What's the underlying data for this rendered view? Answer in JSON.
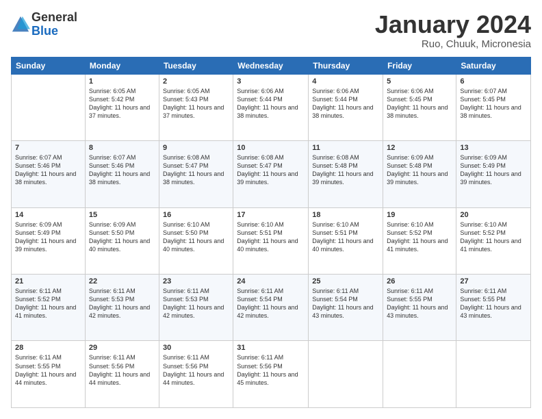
{
  "header": {
    "logo_general": "General",
    "logo_blue": "Blue",
    "month_title": "January 2024",
    "location": "Ruo, Chuuk, Micronesia"
  },
  "weekdays": [
    "Sunday",
    "Monday",
    "Tuesday",
    "Wednesday",
    "Thursday",
    "Friday",
    "Saturday"
  ],
  "weeks": [
    [
      {
        "day": "",
        "sunrise": "",
        "sunset": "",
        "daylight": ""
      },
      {
        "day": "1",
        "sunrise": "Sunrise: 6:05 AM",
        "sunset": "Sunset: 5:42 PM",
        "daylight": "Daylight: 11 hours and 37 minutes."
      },
      {
        "day": "2",
        "sunrise": "Sunrise: 6:05 AM",
        "sunset": "Sunset: 5:43 PM",
        "daylight": "Daylight: 11 hours and 37 minutes."
      },
      {
        "day": "3",
        "sunrise": "Sunrise: 6:06 AM",
        "sunset": "Sunset: 5:44 PM",
        "daylight": "Daylight: 11 hours and 38 minutes."
      },
      {
        "day": "4",
        "sunrise": "Sunrise: 6:06 AM",
        "sunset": "Sunset: 5:44 PM",
        "daylight": "Daylight: 11 hours and 38 minutes."
      },
      {
        "day": "5",
        "sunrise": "Sunrise: 6:06 AM",
        "sunset": "Sunset: 5:45 PM",
        "daylight": "Daylight: 11 hours and 38 minutes."
      },
      {
        "day": "6",
        "sunrise": "Sunrise: 6:07 AM",
        "sunset": "Sunset: 5:45 PM",
        "daylight": "Daylight: 11 hours and 38 minutes."
      }
    ],
    [
      {
        "day": "7",
        "sunrise": "Sunrise: 6:07 AM",
        "sunset": "Sunset: 5:46 PM",
        "daylight": "Daylight: 11 hours and 38 minutes."
      },
      {
        "day": "8",
        "sunrise": "Sunrise: 6:07 AM",
        "sunset": "Sunset: 5:46 PM",
        "daylight": "Daylight: 11 hours and 38 minutes."
      },
      {
        "day": "9",
        "sunrise": "Sunrise: 6:08 AM",
        "sunset": "Sunset: 5:47 PM",
        "daylight": "Daylight: 11 hours and 38 minutes."
      },
      {
        "day": "10",
        "sunrise": "Sunrise: 6:08 AM",
        "sunset": "Sunset: 5:47 PM",
        "daylight": "Daylight: 11 hours and 39 minutes."
      },
      {
        "day": "11",
        "sunrise": "Sunrise: 6:08 AM",
        "sunset": "Sunset: 5:48 PM",
        "daylight": "Daylight: 11 hours and 39 minutes."
      },
      {
        "day": "12",
        "sunrise": "Sunrise: 6:09 AM",
        "sunset": "Sunset: 5:48 PM",
        "daylight": "Daylight: 11 hours and 39 minutes."
      },
      {
        "day": "13",
        "sunrise": "Sunrise: 6:09 AM",
        "sunset": "Sunset: 5:49 PM",
        "daylight": "Daylight: 11 hours and 39 minutes."
      }
    ],
    [
      {
        "day": "14",
        "sunrise": "Sunrise: 6:09 AM",
        "sunset": "Sunset: 5:49 PM",
        "daylight": "Daylight: 11 hours and 39 minutes."
      },
      {
        "day": "15",
        "sunrise": "Sunrise: 6:09 AM",
        "sunset": "Sunset: 5:50 PM",
        "daylight": "Daylight: 11 hours and 40 minutes."
      },
      {
        "day": "16",
        "sunrise": "Sunrise: 6:10 AM",
        "sunset": "Sunset: 5:50 PM",
        "daylight": "Daylight: 11 hours and 40 minutes."
      },
      {
        "day": "17",
        "sunrise": "Sunrise: 6:10 AM",
        "sunset": "Sunset: 5:51 PM",
        "daylight": "Daylight: 11 hours and 40 minutes."
      },
      {
        "day": "18",
        "sunrise": "Sunrise: 6:10 AM",
        "sunset": "Sunset: 5:51 PM",
        "daylight": "Daylight: 11 hours and 40 minutes."
      },
      {
        "day": "19",
        "sunrise": "Sunrise: 6:10 AM",
        "sunset": "Sunset: 5:52 PM",
        "daylight": "Daylight: 11 hours and 41 minutes."
      },
      {
        "day": "20",
        "sunrise": "Sunrise: 6:10 AM",
        "sunset": "Sunset: 5:52 PM",
        "daylight": "Daylight: 11 hours and 41 minutes."
      }
    ],
    [
      {
        "day": "21",
        "sunrise": "Sunrise: 6:11 AM",
        "sunset": "Sunset: 5:52 PM",
        "daylight": "Daylight: 11 hours and 41 minutes."
      },
      {
        "day": "22",
        "sunrise": "Sunrise: 6:11 AM",
        "sunset": "Sunset: 5:53 PM",
        "daylight": "Daylight: 11 hours and 42 minutes."
      },
      {
        "day": "23",
        "sunrise": "Sunrise: 6:11 AM",
        "sunset": "Sunset: 5:53 PM",
        "daylight": "Daylight: 11 hours and 42 minutes."
      },
      {
        "day": "24",
        "sunrise": "Sunrise: 6:11 AM",
        "sunset": "Sunset: 5:54 PM",
        "daylight": "Daylight: 11 hours and 42 minutes."
      },
      {
        "day": "25",
        "sunrise": "Sunrise: 6:11 AM",
        "sunset": "Sunset: 5:54 PM",
        "daylight": "Daylight: 11 hours and 43 minutes."
      },
      {
        "day": "26",
        "sunrise": "Sunrise: 6:11 AM",
        "sunset": "Sunset: 5:55 PM",
        "daylight": "Daylight: 11 hours and 43 minutes."
      },
      {
        "day": "27",
        "sunrise": "Sunrise: 6:11 AM",
        "sunset": "Sunset: 5:55 PM",
        "daylight": "Daylight: 11 hours and 43 minutes."
      }
    ],
    [
      {
        "day": "28",
        "sunrise": "Sunrise: 6:11 AM",
        "sunset": "Sunset: 5:55 PM",
        "daylight": "Daylight: 11 hours and 44 minutes."
      },
      {
        "day": "29",
        "sunrise": "Sunrise: 6:11 AM",
        "sunset": "Sunset: 5:56 PM",
        "daylight": "Daylight: 11 hours and 44 minutes."
      },
      {
        "day": "30",
        "sunrise": "Sunrise: 6:11 AM",
        "sunset": "Sunset: 5:56 PM",
        "daylight": "Daylight: 11 hours and 44 minutes."
      },
      {
        "day": "31",
        "sunrise": "Sunrise: 6:11 AM",
        "sunset": "Sunset: 5:56 PM",
        "daylight": "Daylight: 11 hours and 45 minutes."
      },
      {
        "day": "",
        "sunrise": "",
        "sunset": "",
        "daylight": ""
      },
      {
        "day": "",
        "sunrise": "",
        "sunset": "",
        "daylight": ""
      },
      {
        "day": "",
        "sunrise": "",
        "sunset": "",
        "daylight": ""
      }
    ]
  ]
}
